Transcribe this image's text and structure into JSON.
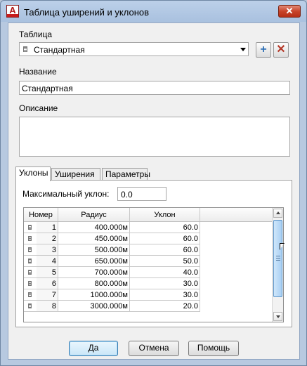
{
  "window": {
    "title": "Таблица уширений и уклонов",
    "close": "✕"
  },
  "table_section": {
    "label": "Таблица",
    "selected": "Стандартная",
    "add_button": "+",
    "delete_button": "✕"
  },
  "name_section": {
    "label": "Название",
    "value": "Стандартная"
  },
  "description_section": {
    "label": "Описание",
    "value": ""
  },
  "tabs": [
    {
      "label": "Уклоны"
    },
    {
      "label": "Уширения"
    },
    {
      "label": "Параметры"
    }
  ],
  "slopes": {
    "max_slope_label": "Максимальный уклон:",
    "max_slope_value": "0.0",
    "columns": [
      "Номер",
      "Радиус",
      "Уклон"
    ],
    "rows": [
      {
        "num": "1",
        "radius": "400.000м",
        "slope": "60.0"
      },
      {
        "num": "2",
        "radius": "450.000м",
        "slope": "60.0"
      },
      {
        "num": "3",
        "radius": "500.000м",
        "slope": "60.0"
      },
      {
        "num": "4",
        "radius": "650.000м",
        "slope": "50.0"
      },
      {
        "num": "5",
        "radius": "700.000м",
        "slope": "40.0"
      },
      {
        "num": "6",
        "radius": "800.000м",
        "slope": "30.0"
      },
      {
        "num": "7",
        "radius": "1000.000м",
        "slope": "30.0"
      },
      {
        "num": "8",
        "radius": "3000.000м",
        "slope": "20.0"
      }
    ]
  },
  "buttons": {
    "ok": "Да",
    "cancel": "Отмена",
    "help": "Помощь"
  }
}
